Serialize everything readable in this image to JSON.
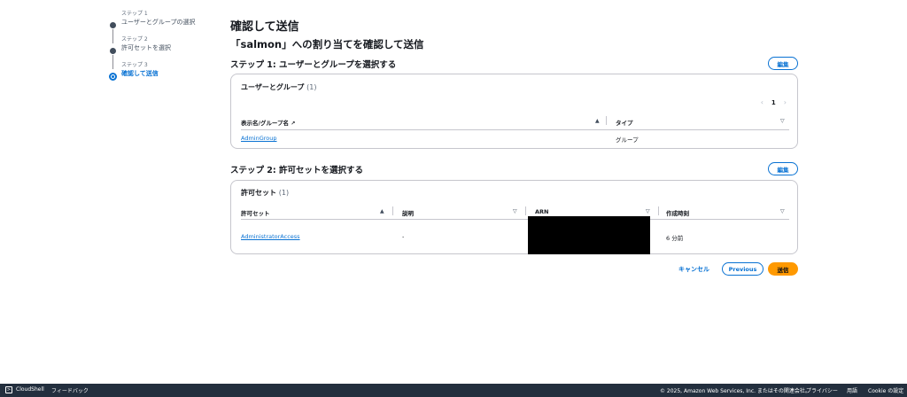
{
  "wizard": {
    "steps": [
      {
        "label": "ステップ 1",
        "name": "ユーザーとグループの選択"
      },
      {
        "label": "ステップ 2",
        "name": "許可セットを選択"
      },
      {
        "label": "ステップ 3",
        "name": "確認して送信"
      }
    ]
  },
  "page": {
    "title": "確認して送信",
    "subtitle": "「salmon」への割り当てを確認して送信"
  },
  "section1": {
    "title": "ステップ 1: ユーザーとグループを選択する",
    "edit_label": "編集",
    "card_title": "ユーザーとグループ",
    "count": "(1)",
    "pager": {
      "prev": "‹",
      "page": "1",
      "next": "›"
    },
    "columns": [
      "表示名/グループ名",
      "タイプ"
    ],
    "rows": [
      {
        "name": "AdminGroup",
        "type": "グループ"
      }
    ]
  },
  "section2": {
    "title": "ステップ 2: 許可セットを選択する",
    "edit_label": "編集",
    "card_title": "許可セット",
    "count": "(1)",
    "columns": [
      "許可セット",
      "説明",
      "ARN",
      "作成時刻"
    ],
    "rows": [
      {
        "name": "AdministratorAccess",
        "description": "-",
        "arn": "",
        "created": "6 分前"
      }
    ]
  },
  "actions": {
    "cancel": "キャンセル",
    "previous": "Previous",
    "submit": "送信"
  },
  "footer": {
    "cloudshell": "CloudShell",
    "feedback": "フィードバック",
    "copyright": "© 2025, Amazon Web Services, Inc. またはその関連会社。",
    "privacy": "プライバシー",
    "terms": "用語",
    "cookie": "Cookie の設定"
  },
  "colors": {
    "accent": "#0972d3",
    "submit": "#ff9900",
    "footer_bg": "#232f3e"
  }
}
